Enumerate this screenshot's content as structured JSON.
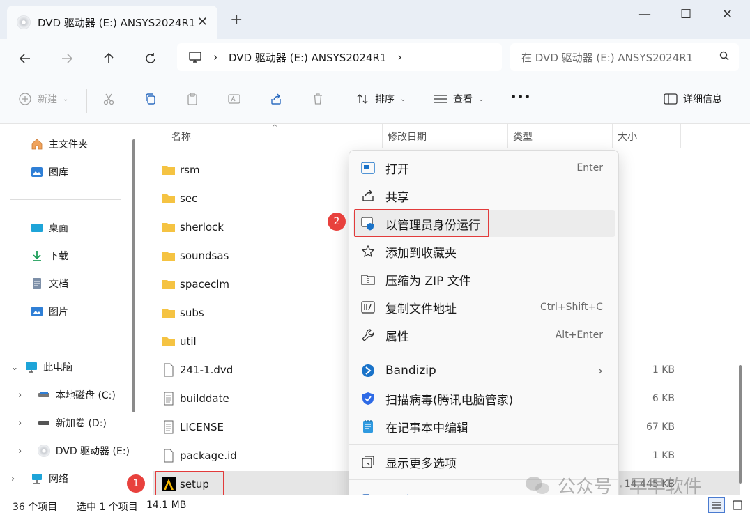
{
  "window": {
    "tab_title": "DVD 驱动器 (E:) ANSYS2024R1",
    "new_tab_symbol": "+",
    "minimize": "—",
    "maximize": "☐",
    "close": "✕"
  },
  "address": {
    "path": "DVD 驱动器 (E:) ANSYS2024R1",
    "search_placeholder": "在 DVD 驱动器 (E:) ANSYS2024R1"
  },
  "toolbar": {
    "new_label": "新建",
    "sort_label": "排序",
    "view_label": "查看",
    "more_label": "•••",
    "details_label": "详细信息"
  },
  "sidebar": {
    "home": "主文件夹",
    "gallery": "图库",
    "desktop": "桌面",
    "downloads": "下载",
    "documents": "文档",
    "pictures": "图片",
    "this_pc": "此电脑",
    "drive_c": "本地磁盘 (C:)",
    "drive_d": "新加卷 (D:)",
    "drive_e": "DVD 驱动器 (E:)",
    "network": "网络"
  },
  "columns": {
    "name": "名称",
    "modified": "修改日期",
    "type": "类型",
    "size": "大小"
  },
  "files": [
    {
      "name": "rsm",
      "kind": "folder",
      "size": ""
    },
    {
      "name": "sec",
      "kind": "folder",
      "size": ""
    },
    {
      "name": "sherlock",
      "kind": "folder",
      "size": ""
    },
    {
      "name": "soundsas",
      "kind": "folder",
      "size": ""
    },
    {
      "name": "spaceclm",
      "kind": "folder",
      "size": ""
    },
    {
      "name": "subs",
      "kind": "folder",
      "size": ""
    },
    {
      "name": "util",
      "kind": "folder",
      "size": ""
    },
    {
      "name": "241-1.dvd",
      "kind": "file",
      "size": "1 KB"
    },
    {
      "name": "builddate",
      "kind": "text",
      "size": "6 KB"
    },
    {
      "name": "LICENSE",
      "kind": "text",
      "size": "67 KB"
    },
    {
      "name": "package.id",
      "kind": "file",
      "size": "1 KB"
    },
    {
      "name": "setup",
      "kind": "app",
      "size": "14,445 KB"
    }
  ],
  "context_menu": {
    "open": "打开",
    "open_shortcut": "Enter",
    "share": "共享",
    "run_as_admin": "以管理员身份运行",
    "add_favorites": "添加到收藏夹",
    "compress_zip": "压缩为 ZIP 文件",
    "copy_path": "复制文件地址",
    "copy_path_shortcut": "Ctrl+Shift+C",
    "properties": "属性",
    "properties_shortcut": "Alt+Enter",
    "bandizip": "Bandizip",
    "virus_scan": "扫描病毒(腾讯电脑管家)",
    "notepad_edit": "在记事本中编辑",
    "more_options": "显示更多选项"
  },
  "annotations": {
    "badge_1": "1",
    "badge_2": "2"
  },
  "status": {
    "count": "36 个项目",
    "selected": "选中 1 个项目",
    "size": "14.1 MB"
  },
  "watermark": "公众号 · 早早软件",
  "colors": {
    "title_bg": "#e9eef5",
    "highlight_red": "#e23b3b",
    "folder_yellow": "#f5c342",
    "accent_blue": "#1a73c9"
  }
}
